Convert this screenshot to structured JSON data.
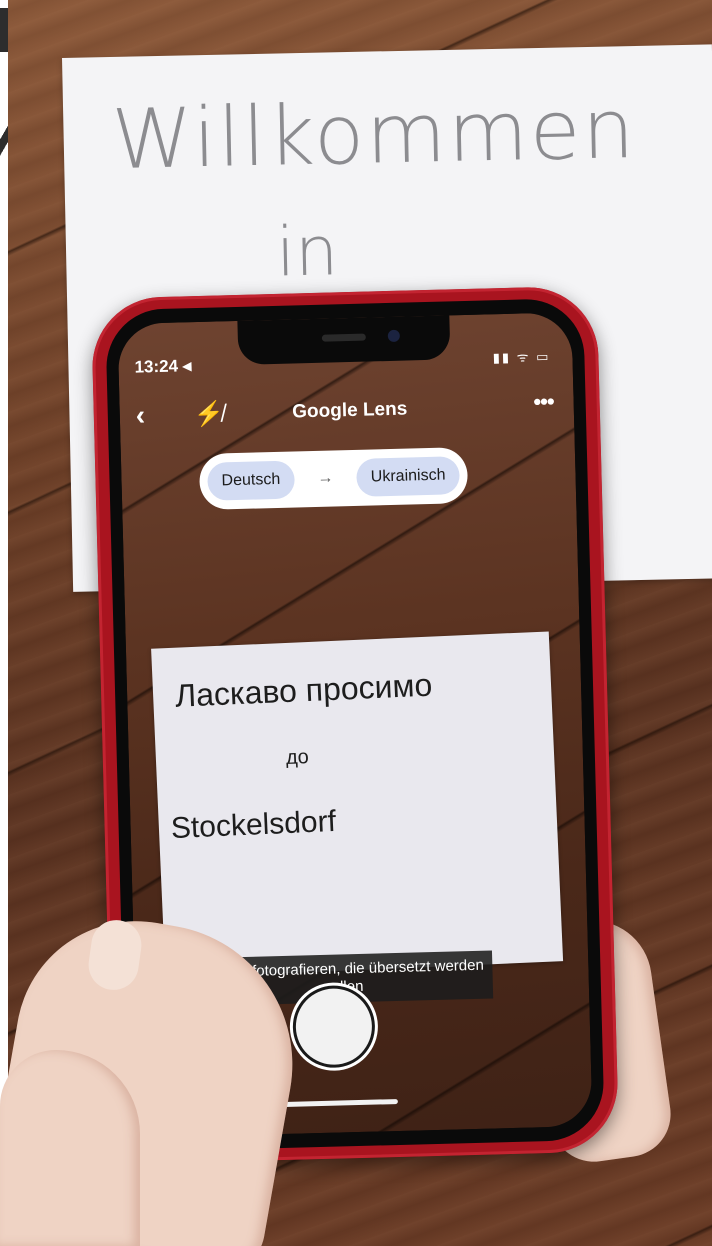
{
  "scene": {
    "background_paper": {
      "line1": "Willkommen",
      "line2": "in"
    }
  },
  "phone": {
    "status_bar": {
      "time": "13:24 ◂"
    },
    "app": {
      "title": "Google Lens"
    },
    "language_pill": {
      "source": "Deutsch",
      "arrow": "→",
      "target": "Ukrainisch"
    },
    "translated_paper": {
      "line1": "Ласкаво просимо",
      "line2": "до",
      "line3": "Stockelsdorf"
    },
    "hint": "Wörter fotografieren, die übersetzt werden sollen",
    "icons": {
      "back": "back-icon",
      "flash": "flash-off-icon",
      "more": "more-icon",
      "gallery": "gallery-icon"
    }
  }
}
